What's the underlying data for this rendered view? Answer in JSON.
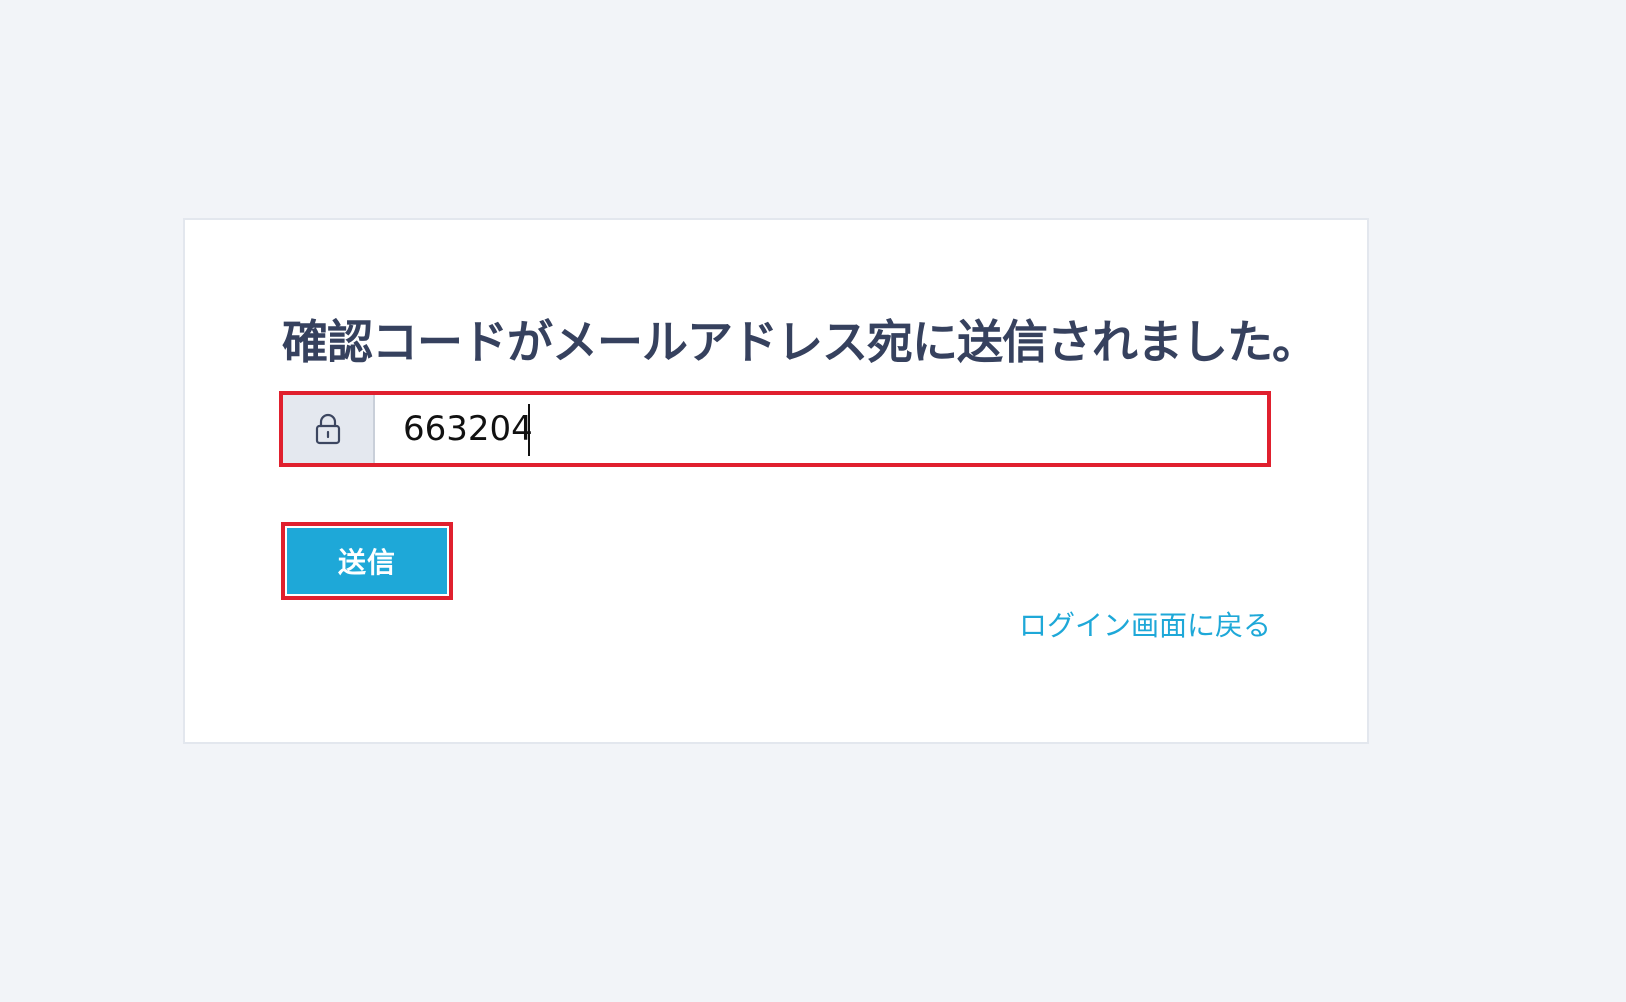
{
  "verification": {
    "heading": "確認コードがメールアドレス宛に送信されました。",
    "code_value": "663204",
    "lock_icon": "lock-icon",
    "submit_label": "送信",
    "back_link_label": "ログイン画面に戻る"
  },
  "colors": {
    "background": "#f2f4f8",
    "card": "#ffffff",
    "heading_text": "#36415e",
    "accent": "#1ea8d8",
    "highlight_border": "#e0202e"
  }
}
